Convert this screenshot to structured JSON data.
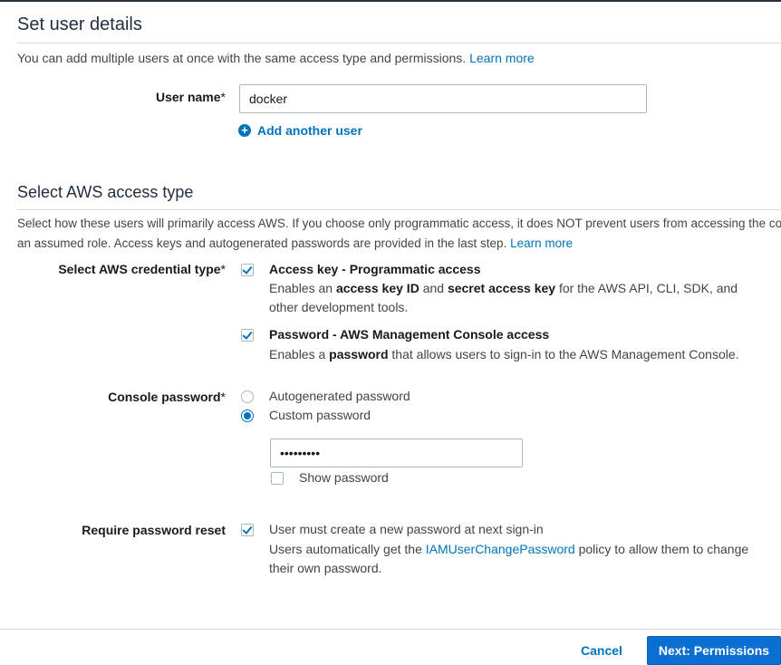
{
  "user_details": {
    "title": "Set user details",
    "description": "You can add multiple users at once with the same access type and permissions.",
    "learn_more": "Learn more",
    "user_name_label": "User name",
    "required_mark": "*",
    "user_name_value": "docker",
    "add_another_user": "Add another user"
  },
  "access_type": {
    "title": "Select AWS access type",
    "description_line1": "Select how these users will primarily access AWS. If you choose only programmatic access, it does NOT prevent users from accessing the console using",
    "description_line2": "an assumed role. Access keys and autogenerated passwords are provided in the last step.",
    "learn_more": "Learn more",
    "credential_label": "Select AWS credential type",
    "access_key": {
      "checked": true,
      "title": "Access key - Programmatic access",
      "desc_pre": "Enables an ",
      "desc_b1": "access key ID",
      "desc_mid": " and ",
      "desc_b2": "secret access key",
      "desc_post": " for the AWS API, CLI, SDK, and",
      "desc_line2": "other development tools."
    },
    "console_access": {
      "checked": true,
      "title": "Password - AWS Management Console access",
      "desc_pre": "Enables a ",
      "desc_b": "password",
      "desc_post": " that allows users to sign-in to the AWS Management Console."
    }
  },
  "console_password": {
    "label": "Console password",
    "options": [
      {
        "label": "Autogenerated password",
        "selected": false
      },
      {
        "label": "Custom password",
        "selected": true
      }
    ],
    "password_value": "•••••••••",
    "show_password_label": "Show password",
    "show_password_checked": false
  },
  "password_reset": {
    "label": "Require password reset",
    "checked": true,
    "option_label": "User must create a new password at next sign-in",
    "desc_pre": "Users automatically get the ",
    "policy_link": "IAMUserChangePassword",
    "desc_post": " policy to allow them to change",
    "desc_line2": "their own password."
  },
  "footer": {
    "cancel_label": "Cancel",
    "next_label": "Next: Permissions"
  }
}
